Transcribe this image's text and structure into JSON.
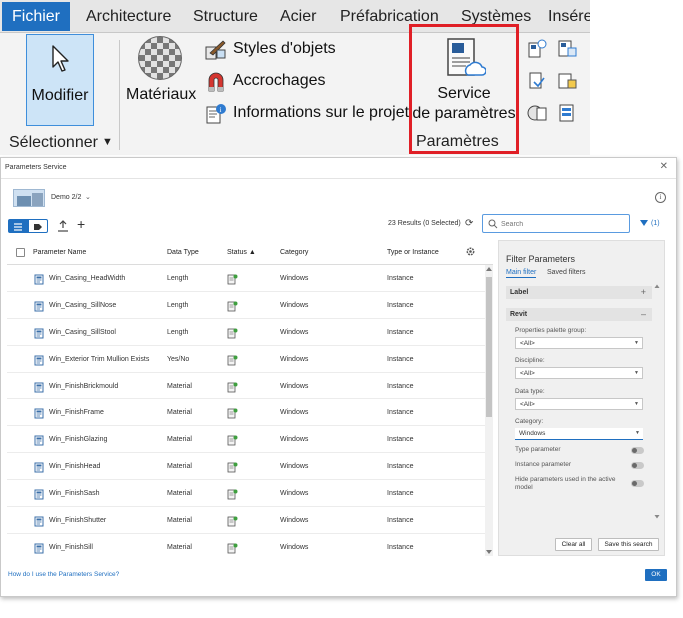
{
  "ribbon": {
    "tabs": [
      "Fichier",
      "Architecture",
      "Structure",
      "Acier",
      "Préfabrication",
      "Systèmes",
      "Insére"
    ],
    "modify_label": "Modifier",
    "select_group_label": "Sélectionner",
    "materials_label": "Matériaux",
    "object_styles_label": "Styles d'objets",
    "snaps_label": "Accrochages",
    "project_info_label": "Informations sur le projet",
    "service_line1": "Service",
    "service_line2": "de paramètres",
    "service_group_label": "Paramètres"
  },
  "dialog": {
    "title": "Parameters Service",
    "project_name": "Demo 2/2",
    "results_text": "23 Results (0 Selected)",
    "search_placeholder": "Search",
    "filter_count": "(1)",
    "columns": {
      "name": "Parameter Name",
      "data_type": "Data Type",
      "status": "Status",
      "category": "Category",
      "type_instance": "Type or Instance"
    },
    "rows": [
      {
        "name": "Win_Casing_HeadWidth",
        "data_type": "Length",
        "category": "Windows",
        "type_instance": "Instance"
      },
      {
        "name": "Win_Casing_SillNose",
        "data_type": "Length",
        "category": "Windows",
        "type_instance": "Instance"
      },
      {
        "name": "Win_Casing_SillStool",
        "data_type": "Length",
        "category": "Windows",
        "type_instance": "Instance"
      },
      {
        "name": "Win_Exterior Trim Mullion Exists",
        "data_type": "Yes/No",
        "category": "Windows",
        "type_instance": "Instance"
      },
      {
        "name": "Win_FinishBrickmould",
        "data_type": "Material",
        "category": "Windows",
        "type_instance": "Instance"
      },
      {
        "name": "Win_FinishFrame",
        "data_type": "Material",
        "category": "Windows",
        "type_instance": "Instance"
      },
      {
        "name": "Win_FinishGlazing",
        "data_type": "Material",
        "category": "Windows",
        "type_instance": "Instance"
      },
      {
        "name": "Win_FinishHead",
        "data_type": "Material",
        "category": "Windows",
        "type_instance": "Instance"
      },
      {
        "name": "Win_FinishSash",
        "data_type": "Material",
        "category": "Windows",
        "type_instance": "Instance"
      },
      {
        "name": "Win_FinishShutter",
        "data_type": "Material",
        "category": "Windows",
        "type_instance": "Instance"
      },
      {
        "name": "Win_FinishSill",
        "data_type": "Material",
        "category": "Windows",
        "type_instance": "Instance"
      }
    ],
    "filter": {
      "title": "Filter Parameters",
      "tab_main": "Main filter",
      "tab_saved": "Saved filters",
      "label_section": "Label",
      "revit_section": "Revit",
      "palette_group_label": "Properties palette group:",
      "palette_group_value": "<All>",
      "discipline_label": "Discipline:",
      "discipline_value": "<All>",
      "data_type_label": "Data type:",
      "data_type_value": "<All>",
      "category_label": "Category:",
      "category_value": "Windows",
      "type_param_label": "Type parameter",
      "instance_param_label": "Instance parameter",
      "hide_used_label_1": "Hide parameters used in the active",
      "hide_used_label_2": "model",
      "clear_all": "Clear all",
      "save_search": "Save this search"
    },
    "help_link": "How do I use the Parameters Service?",
    "ok_label": "OK"
  },
  "colors": {
    "accent": "#1f6fc0",
    "highlight_frame": "#e01f26",
    "status_green": "#3f9f3f"
  }
}
